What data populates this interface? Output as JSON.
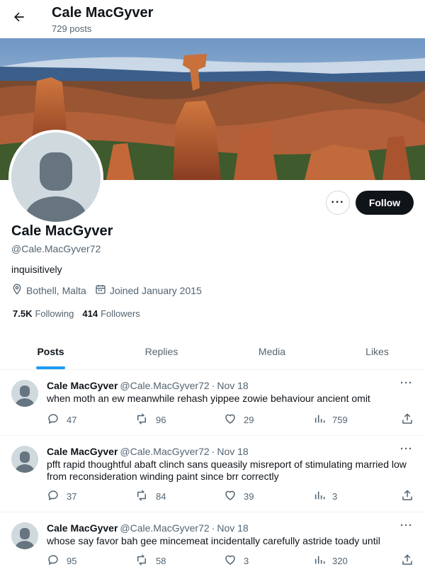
{
  "header": {
    "title": "Cale MacGyver",
    "posts_count": "729 posts"
  },
  "profile": {
    "name": "Cale MacGyver",
    "handle": "@Cale.MacGyver72",
    "bio": "inquisitively",
    "location": "Bothell, Malta",
    "joined": "Joined January 2015",
    "following_count": "7.5K",
    "following_label": "Following",
    "followers_count": "414",
    "followers_label": "Followers",
    "follow_label": "Follow",
    "more_label": "···"
  },
  "tabs": [
    {
      "label": "Posts"
    },
    {
      "label": "Replies"
    },
    {
      "label": "Media"
    },
    {
      "label": "Likes"
    }
  ],
  "tweets": [
    {
      "name": "Cale MacGyver",
      "handle": "@Cale.MacGyver72",
      "date": "Nov 18",
      "text": "when moth an ew meanwhile rehash yippee zowie behaviour ancient omit",
      "replies": "47",
      "reposts": "96",
      "likes": "29",
      "views": "759"
    },
    {
      "name": "Cale MacGyver",
      "handle": "@Cale.MacGyver72",
      "date": "Nov 18",
      "text": "pfft rapid thoughtful abaft clinch sans queasily misreport of stimulating married low from reconsideration winding paint since brr correctly",
      "replies": "37",
      "reposts": "84",
      "likes": "39",
      "views": "3"
    },
    {
      "name": "Cale MacGyver",
      "handle": "@Cale.MacGyver72",
      "date": "Nov 18",
      "text": "whose say favor bah gee mincemeat incidentally carefully astride toady until",
      "replies": "95",
      "reposts": "58",
      "likes": "3",
      "views": "320"
    }
  ],
  "icons": {
    "back": "back-arrow-icon",
    "location": "location-pin-icon",
    "calendar": "calendar-icon",
    "reply": "reply-icon",
    "repost": "repost-icon",
    "like": "heart-icon",
    "views": "views-chart-icon",
    "share": "share-icon"
  },
  "colors": {
    "accent": "#1d9bf0",
    "text": "#0f1419",
    "muted": "#536471",
    "button_dark": "#0f1419"
  }
}
